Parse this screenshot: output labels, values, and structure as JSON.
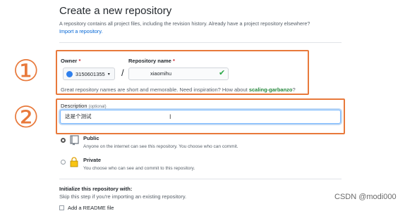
{
  "page": {
    "title": "Create a new repository",
    "subtitle": "A repository contains all project files, including the revision history. Already have a project repository elsewhere?",
    "import_link": "Import a repository."
  },
  "annotations": {
    "one": "①",
    "two": "②",
    "accent_color": "#e8793b"
  },
  "owner": {
    "label": "Owner",
    "required": "*",
    "value": "3150601355",
    "caret": "▾"
  },
  "repository": {
    "label": "Repository name",
    "required": "*",
    "separator": "/",
    "value": "xiaomihu",
    "valid_icon": "✔"
  },
  "name_hint": {
    "text": "Great repository names are short and memorable. Need inspiration? How about",
    "suggestion": "scaling-garbanzo",
    "end": "?"
  },
  "description": {
    "label": "Description",
    "optional": "(optional)",
    "value": "这是个测试"
  },
  "visibility": {
    "public": {
      "title": "Public",
      "desc": "Anyone on the internet can see this repository. You choose who can commit.",
      "selected": true
    },
    "private": {
      "title": "Private",
      "desc": "You choose who can see and commit to this repository.",
      "selected": false
    }
  },
  "init": {
    "title": "Initialize this repository with:",
    "desc": "Skip this step if you're importing an existing repository.",
    "readme_label": "Add a README file"
  },
  "watermark": "CSDN @modi000"
}
